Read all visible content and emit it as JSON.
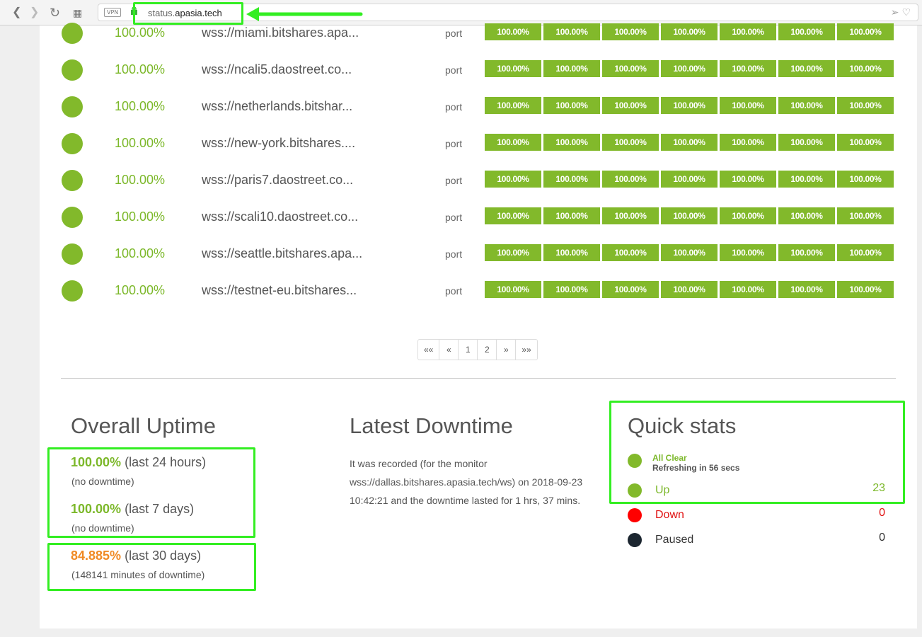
{
  "browser": {
    "vpn": "VPN",
    "url_prefix": "status.",
    "url_domain": "apasia.tech"
  },
  "colors": {
    "up": "#82b92b",
    "down": "#ff0000",
    "paused": "#1c2630",
    "warning": "#f08a24",
    "highlight": "#33ee22"
  },
  "monitors": [
    {
      "uptime": "100.00%",
      "name": "wss://miami.bitshares.apa...",
      "type": "port",
      "history": [
        "100.00%",
        "100.00%",
        "100.00%",
        "100.00%",
        "100.00%",
        "100.00%",
        "100.00%"
      ]
    },
    {
      "uptime": "100.00%",
      "name": "wss://ncali5.daostreet.co...",
      "type": "port",
      "history": [
        "100.00%",
        "100.00%",
        "100.00%",
        "100.00%",
        "100.00%",
        "100.00%",
        "100.00%"
      ]
    },
    {
      "uptime": "100.00%",
      "name": "wss://netherlands.bitshar...",
      "type": "port",
      "history": [
        "100.00%",
        "100.00%",
        "100.00%",
        "100.00%",
        "100.00%",
        "100.00%",
        "100.00%"
      ]
    },
    {
      "uptime": "100.00%",
      "name": "wss://new-york.bitshares....",
      "type": "port",
      "history": [
        "100.00%",
        "100.00%",
        "100.00%",
        "100.00%",
        "100.00%",
        "100.00%",
        "100.00%"
      ]
    },
    {
      "uptime": "100.00%",
      "name": "wss://paris7.daostreet.co...",
      "type": "port",
      "history": [
        "100.00%",
        "100.00%",
        "100.00%",
        "100.00%",
        "100.00%",
        "100.00%",
        "100.00%"
      ]
    },
    {
      "uptime": "100.00%",
      "name": "wss://scali10.daostreet.co...",
      "type": "port",
      "history": [
        "100.00%",
        "100.00%",
        "100.00%",
        "100.00%",
        "100.00%",
        "100.00%",
        "100.00%"
      ]
    },
    {
      "uptime": "100.00%",
      "name": "wss://seattle.bitshares.apa...",
      "type": "port",
      "history": [
        "100.00%",
        "100.00%",
        "100.00%",
        "100.00%",
        "100.00%",
        "100.00%",
        "100.00%"
      ]
    },
    {
      "uptime": "100.00%",
      "name": "wss://testnet-eu.bitshares...",
      "type": "port",
      "history": [
        "100.00%",
        "100.00%",
        "100.00%",
        "100.00%",
        "100.00%",
        "100.00%",
        "100.00%"
      ]
    }
  ],
  "pagination": [
    "««",
    "«",
    "1",
    "2",
    "»",
    "»»"
  ],
  "overall": {
    "title": "Overall Uptime",
    "d24_pct": "100.00%",
    "d24_label": "(last 24 hours)",
    "d24_sub": "(no downtime)",
    "d7_pct": "100.00%",
    "d7_label": "(last 7 days)",
    "d7_sub": "(no downtime)",
    "d30_pct": "84.885%",
    "d30_label": "(last 30 days)",
    "d30_sub": "(148141 minutes of downtime)"
  },
  "downtime": {
    "title": "Latest Downtime",
    "text": "It was recorded (for the monitor wss://dallas.bitshares.apasia.tech/ws) on 2018-09-23 10:42:21 and the downtime lasted for 1 hrs, 37 mins."
  },
  "quick": {
    "title": "Quick stats",
    "status": "All Clear",
    "refresh": "Refreshing in 56 secs",
    "up_label": "Up",
    "up_count": "23",
    "down_label": "Down",
    "down_count": "0",
    "paused_label": "Paused",
    "paused_count": "0"
  }
}
